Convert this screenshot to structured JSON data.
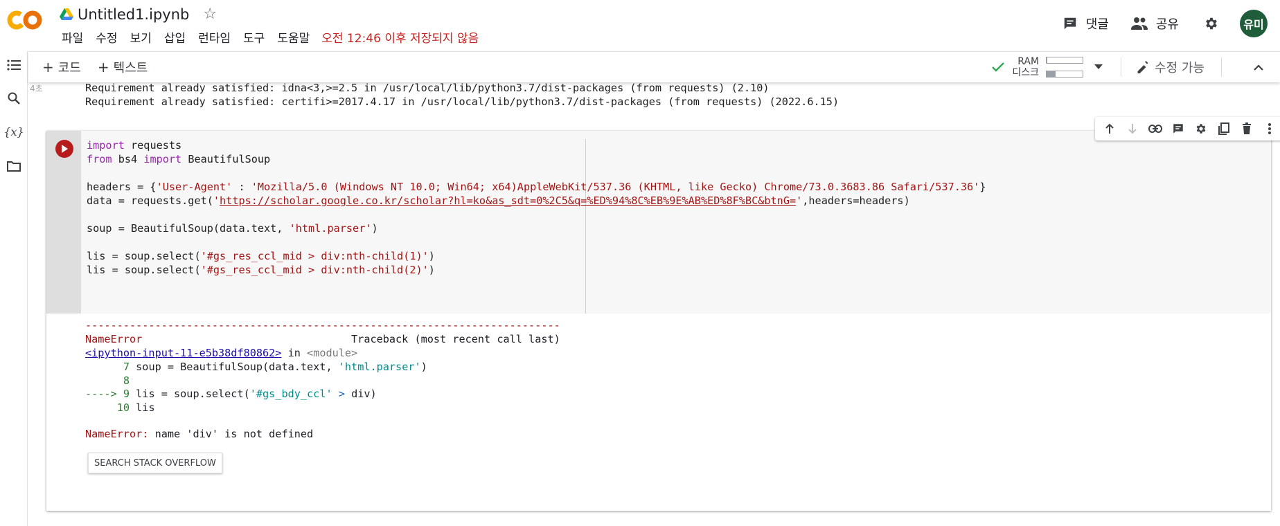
{
  "app": {
    "logo": "CO",
    "notebook_title": "Untitled1.ipynb",
    "menu": [
      "파일",
      "수정",
      "보기",
      "삽입",
      "런타임",
      "도구",
      "도움말"
    ],
    "save_status": "오전 12:46 이후 저장되지 않음"
  },
  "header_actions": {
    "comments_label": "댓글",
    "share_label": "공유",
    "avatar_text": "유미"
  },
  "toolbar": {
    "add_code_label": "코드",
    "add_text_label": "텍스트",
    "ram_label": "RAM",
    "disk_label": "디스크",
    "ram_usage": 0.02,
    "disk_usage": 0.25,
    "edit_mode_label": "수정 가능"
  },
  "prev_output": {
    "exec_time": "4초",
    "lines": [
      "Requirement already satisfied: idna<3,>=2.5 in /usr/local/lib/python3.7/dist-packages (from requests) (2.10)",
      "Requirement already satisfied: certifi>=2017.4.17 in /usr/local/lib/python3.7/dist-packages (from requests) (2022.6.15)"
    ]
  },
  "code": {
    "l1_kw": "import",
    "l1_rest": " requests",
    "l2_kw1": "from",
    "l2_mid": " bs4 ",
    "l2_kw2": "import",
    "l2_rest": " BeautifulSoup",
    "l4_pre": "headers = {",
    "l4_s1": "'User-Agent'",
    "l4_mid": " : ",
    "l4_s2": "'Mozilla/5.0 (Windows NT 10.0; Win64; x64)AppleWebKit/537.36 (KHTML, like Gecko) Chrome/73.0.3683.86 Safari/537.36'",
    "l4_post": "}",
    "l5_pre": "data = requests.get(",
    "l5_q1": "'",
    "l5_url": "https://scholar.google.co.kr/scholar?hl=ko&as_sdt=0%2C5&q=%ED%94%8C%EB%9E%AB%ED%8F%BC&btnG=",
    "l5_q2": "'",
    "l5_post": ",headers=headers)",
    "l7_pre": "soup = BeautifulSoup(data.text, ",
    "l7_str": "'html.parser'",
    "l7_post": ")",
    "l9_pre": "lis = soup.select(",
    "l9_str": "'#gs_res_ccl_mid > div:nth-child(1)'",
    "l9_post": ")",
    "l10_pre": "lis = soup.select(",
    "l10_str": "'#gs_res_ccl_mid > div:nth-child(2)'",
    "l10_post": ")"
  },
  "traceback": {
    "dashes": "---------------------------------------------------------------------------",
    "err_name": "NameError",
    "header_rest": "                                 Traceback (most recent call last)",
    "input_link": "<ipython-input-11-e5b38df80862>",
    "in_text": " in ",
    "module_text": "<module>",
    "t7_num": "      7 ",
    "t7_pre": "soup = BeautifulSoup(data.text, ",
    "t7_str": "'html.parser'",
    "t7_post": ")",
    "t8_num": "      8",
    "t9_arrow": "----> 9 ",
    "t9_pre": "lis = soup.select(",
    "t9_str": "'#gs_bdy_ccl'",
    "t9_op": " > ",
    "t9_post": "div)",
    "t10_num": "     10 ",
    "t10_rest": "lis",
    "final_name": "NameError:",
    "final_msg": " name 'div' is not defined",
    "so_button": "SEARCH STACK OVERFLOW"
  },
  "colors": {
    "brand_orange": "#f9ab00",
    "run_button": "#b71c1c",
    "save_status": "#c5221f",
    "avatar_bg": "#1e5c3a"
  }
}
